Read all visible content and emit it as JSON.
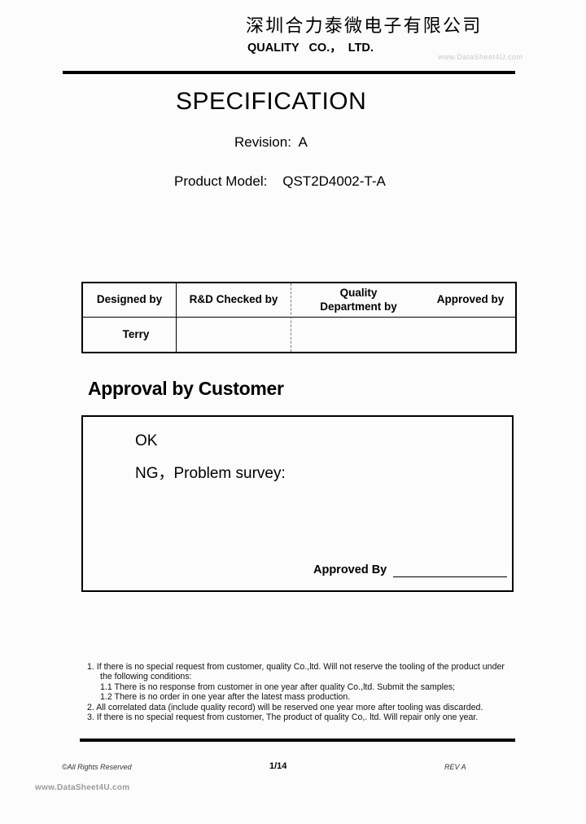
{
  "header": {
    "company_name_cn": "深圳合力泰微电子有限公司",
    "company_name_en": "QUALITY   CO.，  LTD.",
    "watermark": "www.DataSheet4U.com"
  },
  "title": {
    "document_title": "SPECIFICATION",
    "revision_label": "Revision:",
    "revision_value": "A",
    "model_label": "Product Model:",
    "model_value": "QST2D4002-T-A"
  },
  "sign_table": {
    "headers": [
      "Designed by",
      "R&D Checked by",
      "Quality Department by",
      "Approved by"
    ],
    "values": [
      "Terry",
      "",
      "",
      ""
    ]
  },
  "approval": {
    "heading": "Approval by Customer",
    "ok_option": "OK",
    "ng_option": "NG，Problem survey:",
    "approved_by_label": "Approved By"
  },
  "notes": [
    "1. If there is no special request from customer, quality Co.,ltd. Will not reserve the tooling of the product under",
    "the following conditions:",
    "1.1 There is no response from customer in one year after quality Co.,ltd. Submit the samples;",
    "1.2 There is no order in one year after the latest mass production.",
    "2. All correlated data (include quality record) will be reserved one year more after tooling was discarded.",
    "3. If there is no special request from customer, The product of quality Co,. ltd. Will repair only one year."
  ],
  "footer": {
    "copyright": "©All Rights Reserved",
    "page": "1/14",
    "revision": "REV A",
    "site": "www.DataSheet4U.com"
  }
}
